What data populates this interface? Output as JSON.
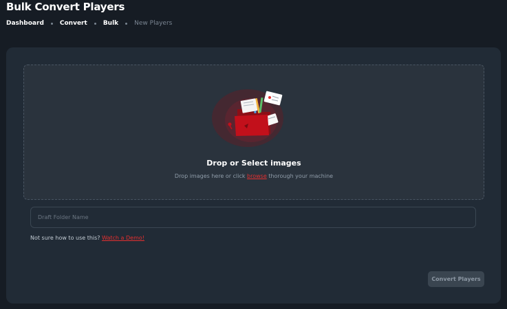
{
  "header": {
    "title": "Bulk Convert Players"
  },
  "breadcrumb": {
    "items": [
      "Dashboard",
      "Convert",
      "Bulk",
      "New Players"
    ]
  },
  "dropzone": {
    "title": "Drop or Select images",
    "subtitle_before": "Drop images here or click",
    "browse_label": "browse",
    "subtitle_after": "thorough your machine",
    "illustration_icon": "upload-folder-illustration"
  },
  "form": {
    "folder_placeholder": "Draft Folder Name",
    "folder_value": ""
  },
  "help": {
    "text": "Not sure how to use this?",
    "link_label": "Watch a Demo!"
  },
  "actions": {
    "convert_label": "Convert Players"
  },
  "colors": {
    "background": "#161c24",
    "card": "#212b36",
    "dropzone": "#2a333d",
    "accent": "#e52f2f",
    "button_disabled": "#3a4550"
  }
}
